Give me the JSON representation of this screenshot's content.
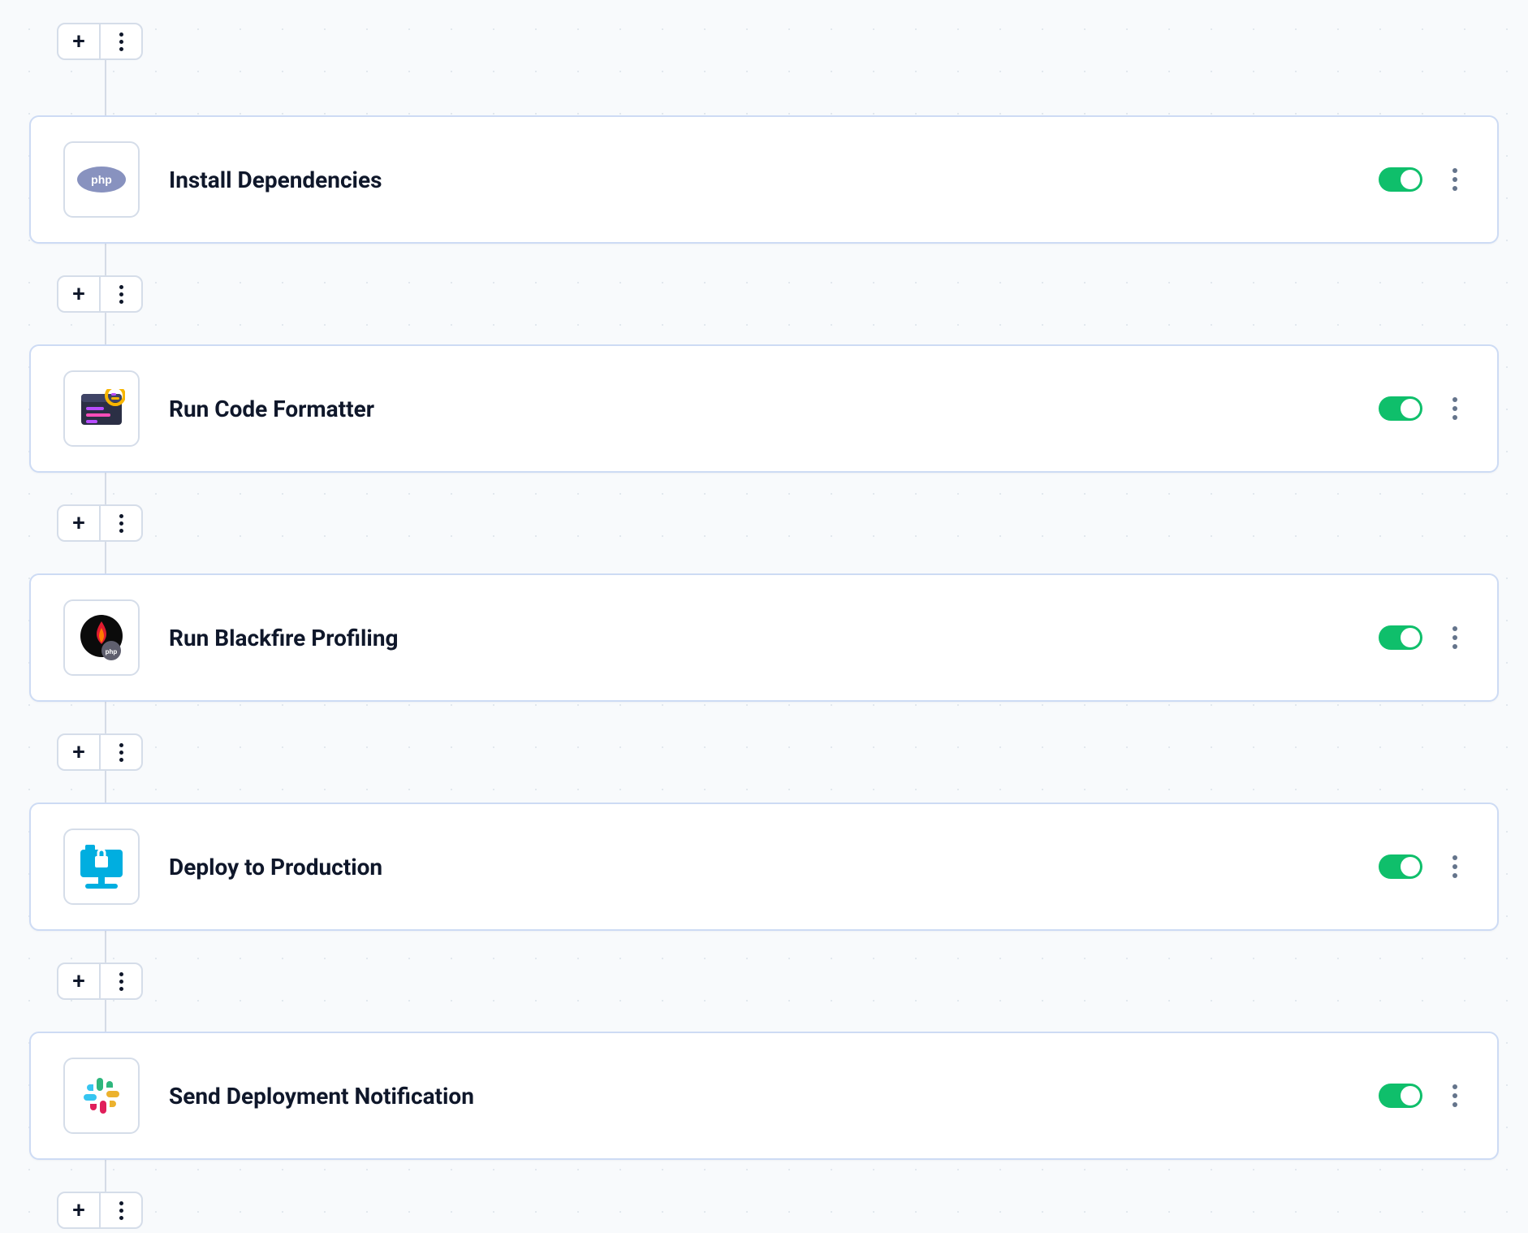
{
  "steps": [
    {
      "title": "Install Dependencies",
      "icon": "php-icon",
      "enabled": true
    },
    {
      "title": "Run Code Formatter",
      "icon": "code-format-icon",
      "enabled": true
    },
    {
      "title": "Run Blackfire Profiling",
      "icon": "blackfire-icon",
      "enabled": true
    },
    {
      "title": "Deploy to Production",
      "icon": "deploy-icon",
      "enabled": true
    },
    {
      "title": "Send Deployment Notification",
      "icon": "slack-icon",
      "enabled": true
    }
  ]
}
